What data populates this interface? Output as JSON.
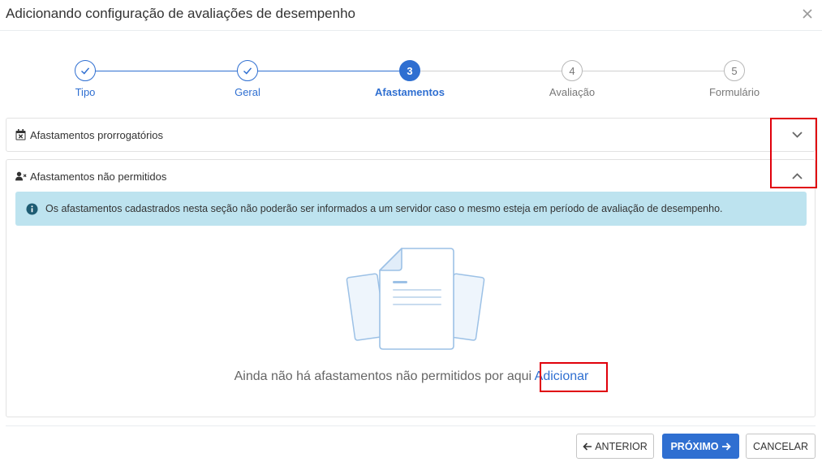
{
  "modal": {
    "title": "Adicionando configuração de avaliações de desempenho",
    "close_icon": "close-icon"
  },
  "stepper": {
    "steps": [
      {
        "label": "Tipo",
        "marker": "",
        "state": "done"
      },
      {
        "label": "Geral",
        "marker": "",
        "state": "done"
      },
      {
        "label": "Afastamentos",
        "marker": "3",
        "state": "active"
      },
      {
        "label": "Avaliação",
        "marker": "4",
        "state": "todo"
      },
      {
        "label": "Formulário",
        "marker": "5",
        "state": "todo"
      }
    ]
  },
  "panels": {
    "prorrogatorios": {
      "title": "Afastamentos prorrogatórios",
      "icon": "calendar-x-icon",
      "expanded": false
    },
    "nao_permitidos": {
      "title": "Afastamentos não permitidos",
      "icon": "user-x-icon",
      "expanded": true,
      "alert": "Os afastamentos cadastrados nesta seção não poderão ser informados a um servidor caso o mesmo esteja em período de avaliação de desempenho.",
      "empty_text": "Ainda não há afastamentos não permitidos por aqui",
      "add_link": "Adicionar"
    }
  },
  "footer": {
    "prev_label": "ANTERIOR",
    "next_label": "PRÓXIMO",
    "cancel_label": "CANCELAR"
  },
  "colors": {
    "primary": "#2f6fd1",
    "alert_bg": "#bde3ef",
    "highlight": "#e0000b"
  }
}
